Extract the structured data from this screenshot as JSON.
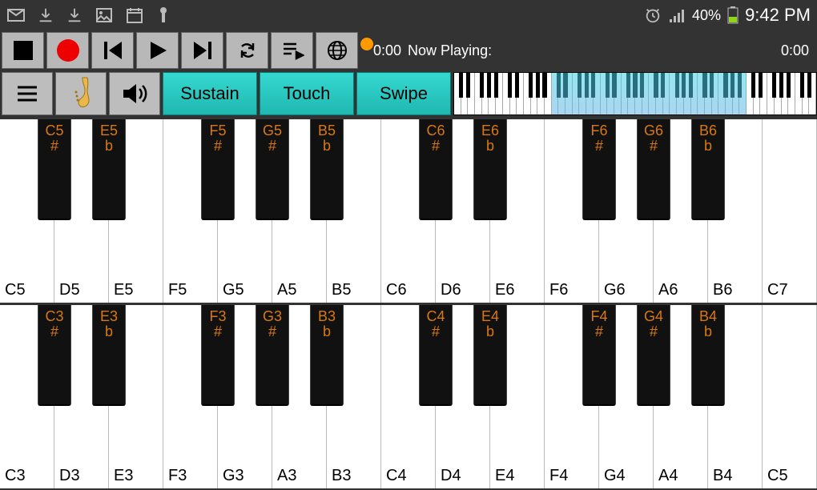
{
  "status": {
    "battery": "40%",
    "time": "9:42 PM"
  },
  "playback": {
    "elapsed": "0:00",
    "label": "Now Playing:",
    "total": "0:00"
  },
  "modes": {
    "sustain": "Sustain",
    "touch": "Touch",
    "swipe": "Swipe"
  },
  "keyboards": [
    {
      "whiteKeys": [
        "C5",
        "D5",
        "E5",
        "F5",
        "G5",
        "A5",
        "B5",
        "C6",
        "D6",
        "E6",
        "F6",
        "G6",
        "A6",
        "B6",
        "C7"
      ],
      "blackKeys": [
        {
          "pos": 0,
          "l1": "C5",
          "l2": "#"
        },
        {
          "pos": 1,
          "l1": "E5",
          "l2": "b"
        },
        {
          "pos": 3,
          "l1": "F5",
          "l2": "#"
        },
        {
          "pos": 4,
          "l1": "G5",
          "l2": "#"
        },
        {
          "pos": 5,
          "l1": "B5",
          "l2": "b"
        },
        {
          "pos": 7,
          "l1": "C6",
          "l2": "#"
        },
        {
          "pos": 8,
          "l1": "E6",
          "l2": "b"
        },
        {
          "pos": 10,
          "l1": "F6",
          "l2": "#"
        },
        {
          "pos": 11,
          "l1": "G6",
          "l2": "#"
        },
        {
          "pos": 12,
          "l1": "B6",
          "l2": "b"
        }
      ]
    },
    {
      "whiteKeys": [
        "C3",
        "D3",
        "E3",
        "F3",
        "G3",
        "A3",
        "B3",
        "C4",
        "D4",
        "E4",
        "F4",
        "G4",
        "A4",
        "B4",
        "C5"
      ],
      "blackKeys": [
        {
          "pos": 0,
          "l1": "C3",
          "l2": "#"
        },
        {
          "pos": 1,
          "l1": "E3",
          "l2": "b"
        },
        {
          "pos": 3,
          "l1": "F3",
          "l2": "#"
        },
        {
          "pos": 4,
          "l1": "G3",
          "l2": "#"
        },
        {
          "pos": 5,
          "l1": "B3",
          "l2": "b"
        },
        {
          "pos": 7,
          "l1": "C4",
          "l2": "#"
        },
        {
          "pos": 8,
          "l1": "E4",
          "l2": "b"
        },
        {
          "pos": 10,
          "l1": "F4",
          "l2": "#"
        },
        {
          "pos": 11,
          "l1": "G4",
          "l2": "#"
        },
        {
          "pos": 12,
          "l1": "B4",
          "l2": "b"
        }
      ]
    }
  ],
  "miniPiano": {
    "totalWhite": 52,
    "highlightStart": 14,
    "highlightWidth": 28
  }
}
